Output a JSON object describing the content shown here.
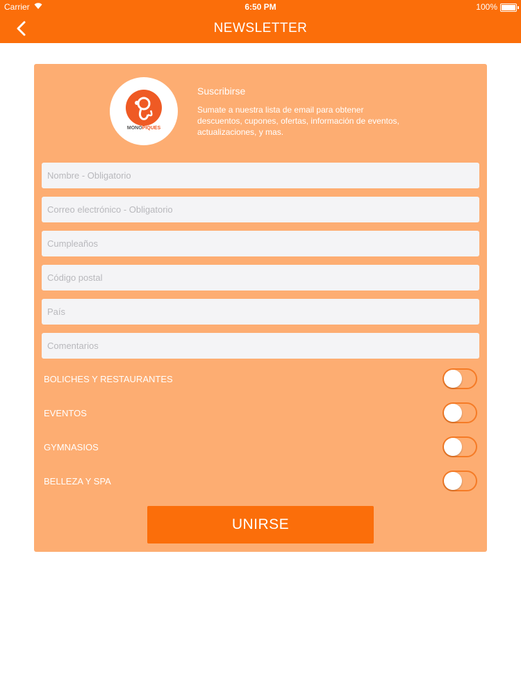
{
  "status_bar": {
    "carrier": "Carrier",
    "time": "6:50 PM",
    "battery": "100%"
  },
  "nav": {
    "title": "NEWSLETTER",
    "back_icon": "chevron-left-icon"
  },
  "colors": {
    "accent": "#fb6e0a",
    "card": "#fdad72",
    "field": "#f4f4f6"
  },
  "intro": {
    "logo_text_1": "MONO",
    "logo_text_2": "PIQUES",
    "title": "Suscribirse",
    "text": "Sumate a nuestra lista de email para obtener descuentos, cupones, ofertas, información de eventos, actualizaciones, y mas."
  },
  "form": {
    "fields": [
      {
        "placeholder": "Nombre - Obligatorio",
        "value": ""
      },
      {
        "placeholder": "Correo electrónico - Obligatorio",
        "value": ""
      },
      {
        "placeholder": "Cumpleaños",
        "value": ""
      },
      {
        "placeholder": "Código postal",
        "value": ""
      },
      {
        "placeholder": "País",
        "value": ""
      },
      {
        "placeholder": "Comentarios",
        "value": ""
      }
    ],
    "toggles": [
      {
        "label": "BOLICHES Y RESTAURANTES",
        "on": false
      },
      {
        "label": "EVENTOS",
        "on": false
      },
      {
        "label": "GYMNASIOS",
        "on": false
      },
      {
        "label": "BELLEZA Y SPA",
        "on": false
      }
    ],
    "submit_label": "UNIRSE"
  }
}
